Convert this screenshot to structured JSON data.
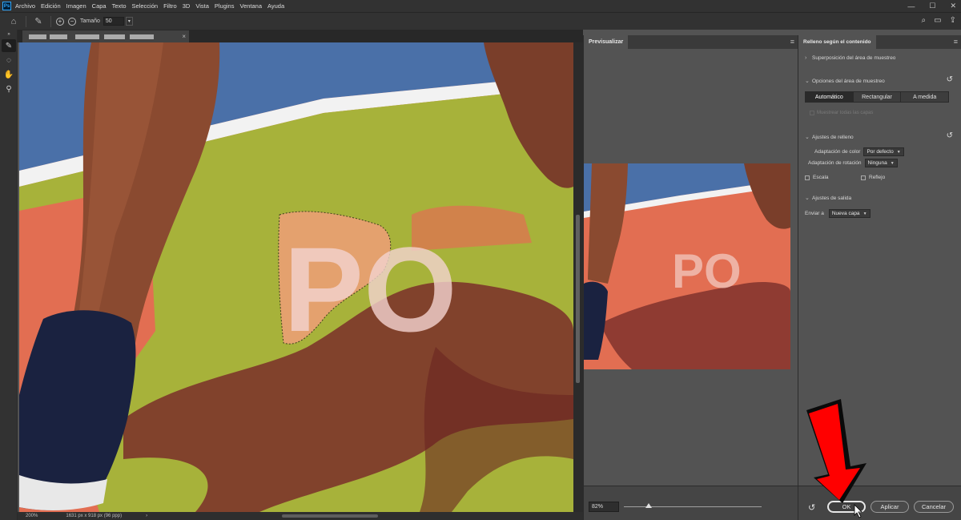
{
  "app": {
    "logo": "Ps"
  },
  "menu": [
    "Archivo",
    "Edición",
    "Imagen",
    "Capa",
    "Texto",
    "Selección",
    "Filtro",
    "3D",
    "Vista",
    "Plugins",
    "Ventana",
    "Ayuda"
  ],
  "window_controls": {
    "minimize": "—",
    "maximize": "☐",
    "close": "✕"
  },
  "options_bar": {
    "size_label": "Tamaño",
    "size_value": "50"
  },
  "document": {
    "tab_close": "×",
    "zoom": "200%",
    "info": "1631 px x 918 px (96 ppp)",
    "canvas_text": "PO"
  },
  "preview_panel": {
    "tab": "Previsualizar",
    "zoom_value": "82%",
    "zoom_slider": 0.18,
    "preview_text": "PO"
  },
  "properties": {
    "tab": "Relleno según el contenido",
    "sample_overlay_label": "Superposición del área de muestreo",
    "sample_options_label": "Opciones del área de muestreo",
    "sample_modes": [
      "Automático",
      "Rectangular",
      "A medida"
    ],
    "selected_mode": "Automático",
    "sample_all_layers": "Muestrear todas las capas",
    "fill_settings_label": "Ajustes de relleno",
    "color_adaptation_label": "Adaptación de color",
    "color_adaptation_value": "Por defecto",
    "rotation_adaptation_label": "Adaptación de rotación",
    "rotation_adaptation_value": "Ninguna",
    "scale_label": "Escala",
    "mirror_label": "Reflejo",
    "output_settings_label": "Ajustes de salida",
    "output_to_label": "Enviar a",
    "output_to_value": "Nueva capa"
  },
  "buttons": {
    "ok": "OK",
    "apply": "Aplicar",
    "cancel": "Cancelar"
  },
  "colors": {
    "court_red": "#e26e52",
    "court_blue": "#4a70a8",
    "overlay_green": "#a7b23a",
    "shadow": "#7a2e2a",
    "annotation_arrow": "#ff0000"
  }
}
